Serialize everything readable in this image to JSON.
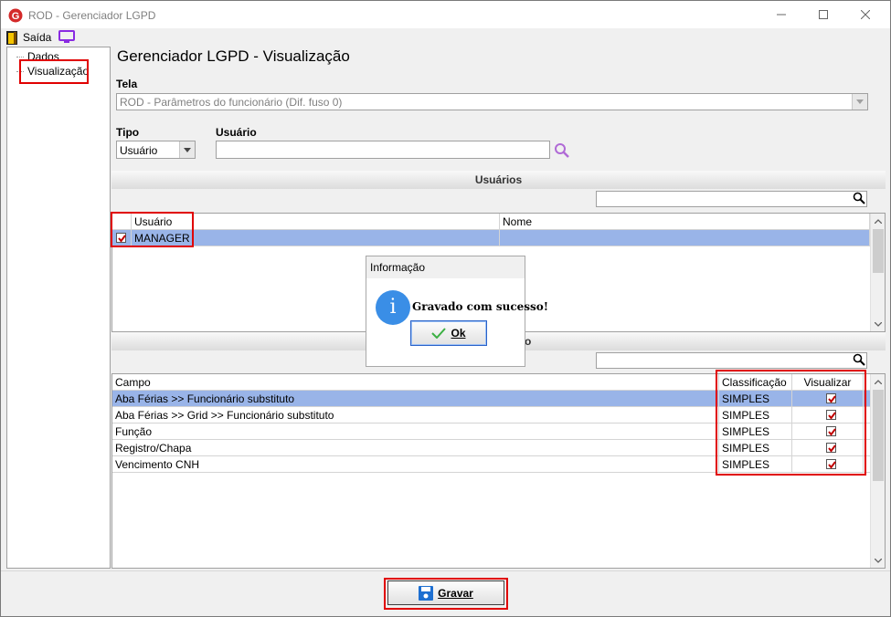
{
  "window": {
    "title": "ROD - Gerenciador LGPD"
  },
  "toolbar": {
    "exit_label": "Saída"
  },
  "tree": {
    "items": [
      {
        "label": "Dados"
      },
      {
        "label": "Visualização"
      }
    ]
  },
  "main": {
    "title": "Gerenciador LGPD - Visualização",
    "tela_label": "Tela",
    "tela_value": "ROD - Parâmetros do funcionário (Dif. fuso 0)",
    "tipo_label": "Tipo",
    "tipo_value": "Usuário",
    "usuario_label": "Usuário",
    "usuario_value": ""
  },
  "users_section": {
    "header": "Usuários",
    "search_value": "",
    "columns": [
      "Usuário",
      "Nome"
    ],
    "rows": [
      {
        "checked": true,
        "usuario": "MANAGER",
        "nome": ""
      }
    ]
  },
  "fields_section": {
    "header_partial": "o",
    "search_value": "",
    "columns": [
      "Campo",
      "Classificação",
      "Visualizar"
    ],
    "rows": [
      {
        "campo": "Aba Férias >> Funcionário substituto",
        "classificacao": "SIMPLES",
        "visualizar": true
      },
      {
        "campo": "Aba Férias >> Grid >> Funcionário substituto",
        "classificacao": "SIMPLES",
        "visualizar": true
      },
      {
        "campo": "Função",
        "classificacao": "SIMPLES",
        "visualizar": true
      },
      {
        "campo": "Registro/Chapa",
        "classificacao": "SIMPLES",
        "visualizar": true
      },
      {
        "campo": "Vencimento CNH",
        "classificacao": "SIMPLES",
        "visualizar": true
      }
    ]
  },
  "dialog": {
    "title": "Informação",
    "message": "Gravado com sucesso!",
    "ok_label": "Ok",
    "icon_glyph": "i"
  },
  "footer": {
    "save_label": "Gravar"
  },
  "colors": {
    "selection": "#99b4e8",
    "highlight_box": "#e00000",
    "info_icon": "#3a8ee6",
    "checkmark": "#c00000"
  }
}
